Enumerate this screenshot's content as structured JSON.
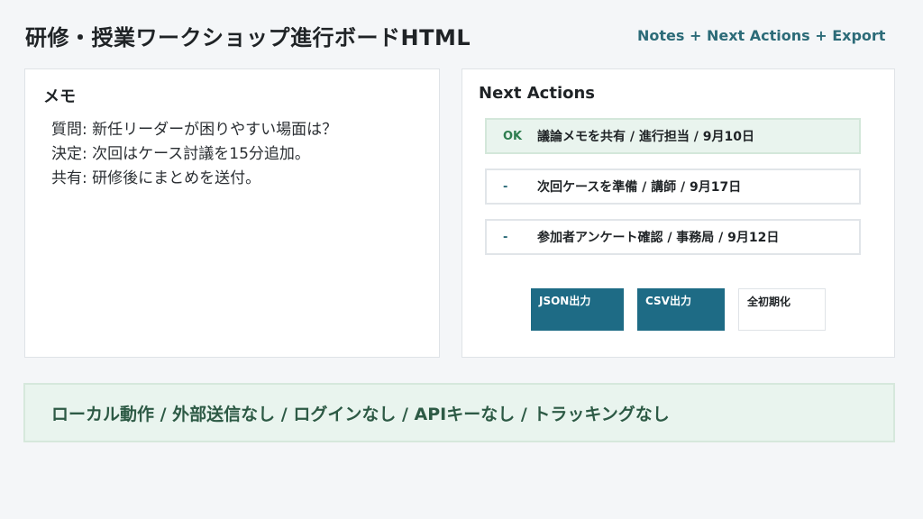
{
  "header": {
    "title": "研修・授業ワークショップ進行ボードHTML",
    "subtitle": "Notes + Next Actions + Export"
  },
  "memo": {
    "title": "メモ",
    "lines": [
      "質問: 新任リーダーが困りやすい場面は？",
      "決定: 次回はケース討議を15分追加。",
      "共有: 研修後にまとめを送付。"
    ]
  },
  "actions": {
    "title": "Next Actions",
    "items": [
      {
        "status": "OK",
        "text": "議論メモを共有 / 進行担当 / 9月10日"
      },
      {
        "status": "-",
        "text": "次回ケースを準備 / 講師 / 9月17日"
      },
      {
        "status": "-",
        "text": "参加者アンケート確認 / 事務局 / 9月12日"
      }
    ],
    "buttons": {
      "json": "JSON出力",
      "csv": "CSV出力",
      "reset": "全初期化"
    }
  },
  "footer": {
    "text": "ローカル動作 / 外部送信なし / ログインなし / APIキーなし / トラッキングなし"
  },
  "colors": {
    "accent": "#1e6b85",
    "success_bg": "#e9f4ee",
    "success_text": "#2e7d4f"
  }
}
